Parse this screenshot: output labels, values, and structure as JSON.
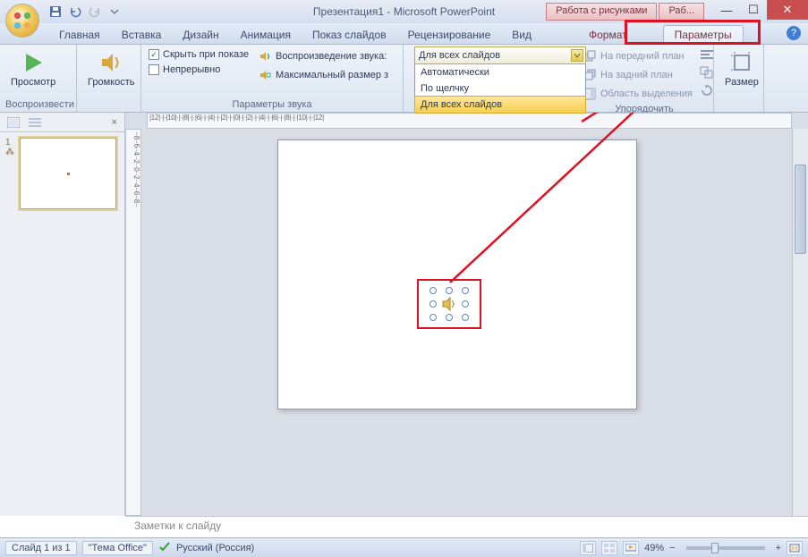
{
  "title": "Презентация1 - Microsoft PowerPoint",
  "context_tabs": {
    "a": "Работа с рисунками",
    "b": "Раб..."
  },
  "tabs": {
    "home": "Главная",
    "insert": "Вставка",
    "design": "Дизайн",
    "anim": "Анимация",
    "show": "Показ слайдов",
    "review": "Рецензирование",
    "view": "Вид",
    "format": "Формат",
    "params": "Параметры"
  },
  "ribbon": {
    "preview": "Просмотр",
    "preview_group": "Воспроизвести",
    "volume": "Громкость",
    "hide": "Скрыть при показе",
    "loop": "Непрерывно",
    "play_sound": "Воспроизведение звука:",
    "max_size": "Максимальный размер з",
    "sound_group": "Параметры звука",
    "dd_selected": "Для всех слайдов",
    "dd_items": {
      "a": "Автоматически",
      "b": "По щелчку",
      "c": "Для всех слайдов"
    },
    "bring_front": "На передний план",
    "send_back": "На задний план",
    "selection_pane": "Область выделения",
    "arrange_group": "Упорядочить",
    "size": "Размер",
    "size_group": ""
  },
  "notes": "Заметки к слайду",
  "status": {
    "slide": "Слайд 1 из 1",
    "theme": "\"Тема Office\"",
    "lang": "Русский (Россия)",
    "zoom": "49%"
  },
  "ruler_h": "|12|·|·|10|·|·|8|·|·|6|·|·|4|·|·|2|·|·|0|·|·|2|·|·|4|·|·|6|·|·|8|·|·|10|·|·|12|",
  "ruler_v": "··8··6··4··2··0··2··4··6··8··"
}
